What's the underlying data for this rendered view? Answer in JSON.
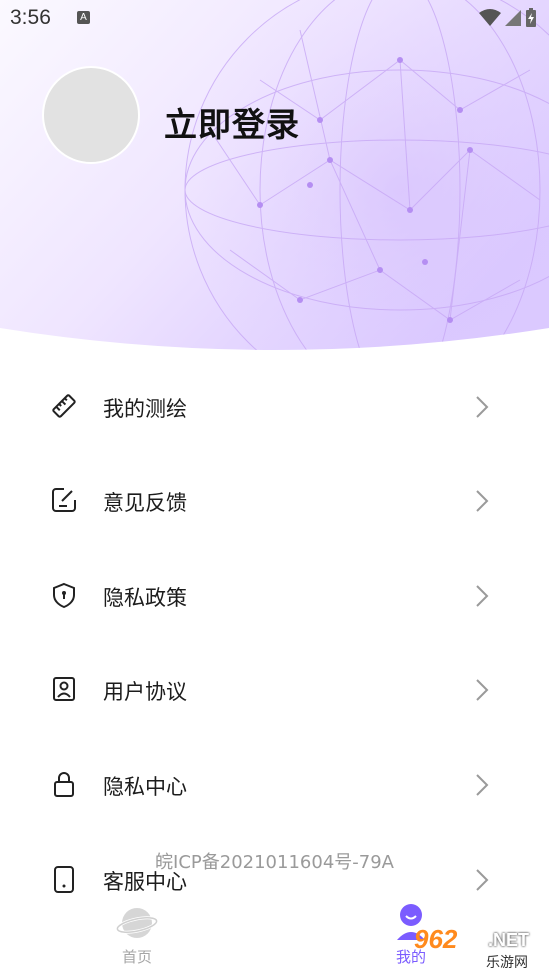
{
  "status_bar": {
    "time": "3:56",
    "notification_badge": "A"
  },
  "profile": {
    "login_text": "立即登录"
  },
  "menu": [
    {
      "label": "我的测绘",
      "icon": "ruler-icon"
    },
    {
      "label": "意见反馈",
      "icon": "edit-note-icon"
    },
    {
      "label": "隐私政策",
      "icon": "shield-lock-icon"
    },
    {
      "label": "用户协议",
      "icon": "user-badge-icon"
    },
    {
      "label": "隐私中心",
      "icon": "lock-icon"
    },
    {
      "label": "客服中心",
      "icon": "phone-icon"
    }
  ],
  "footer": {
    "icp": "皖ICP备2021011604号-79A"
  },
  "bottom_nav": [
    {
      "label": "首页",
      "icon": "planet-icon",
      "active": false
    },
    {
      "label": "我的",
      "icon": "user-smile-icon",
      "active": true
    }
  ],
  "watermark": {
    "number": "962",
    "domain": ".NET",
    "sub": "乐游网"
  },
  "colors": {
    "accent": "#7b5cff",
    "header_gradient_start": "#f6f1ff",
    "header_gradient_end": "#d9c6ff"
  }
}
